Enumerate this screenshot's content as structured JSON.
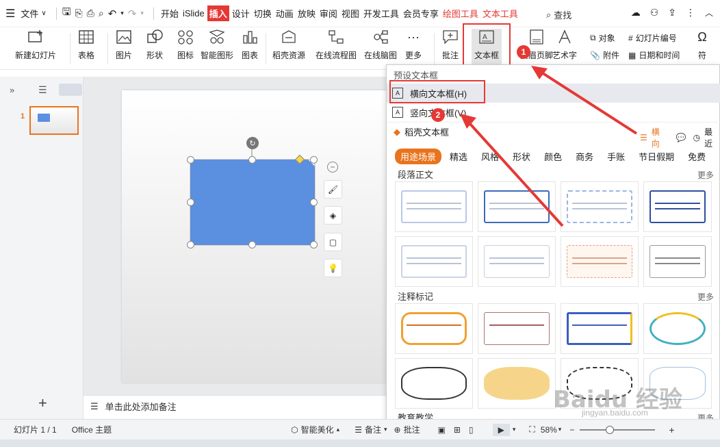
{
  "menubar": {
    "file_label": "文件",
    "tabs": [
      "开始",
      "iSlide",
      "插入",
      "设计",
      "切换",
      "动画",
      "放映",
      "审阅",
      "视图",
      "开发工具",
      "会员专享",
      "绘图工具",
      "文本工具"
    ],
    "search_label": "查找"
  },
  "ribbon": {
    "new_slide": "新建幻灯片",
    "table": "表格",
    "picture": "图片",
    "shape": "形状",
    "icon": "图标",
    "smart_graphic": "智能图形",
    "chart": "图表",
    "docer_resources": "稻壳资源",
    "online_flowchart": "在线流程图",
    "online_mindmap": "在线脑图",
    "more": "更多",
    "comment": "批注",
    "textbox": "文本框",
    "header_footer": "页眉页脚",
    "wordart": "艺术字",
    "object": "对象",
    "attachment": "附件",
    "slide_number": "幻灯片编号",
    "datetime": "日期和时间",
    "symbol": "符"
  },
  "leftpanel": {
    "slide_index": "1"
  },
  "notes": {
    "placeholder": "单击此处添加备注"
  },
  "dropdown": {
    "preset_title": "预设文本框",
    "horizontal": "横向文本框(H)",
    "vertical": "竖向文本框(V)",
    "docer_title": "稻壳文本框",
    "orientation": "横向",
    "recent": "最近",
    "categories": [
      "用途场景",
      "精选",
      "风格",
      "形状",
      "颜色",
      "商务",
      "手账",
      "节日假期",
      "免费"
    ],
    "section1": "段落正文",
    "section2": "注释标记",
    "section3": "教育教学",
    "more": "更多"
  },
  "status": {
    "slide_count": "幻灯片 1 / 1",
    "theme": "Office 主题",
    "smart_beautify": "智能美化",
    "notes": "备注",
    "comments": "批注",
    "zoom": "58%"
  },
  "annotations": {
    "badge1": "1",
    "badge2": "2"
  },
  "watermark": {
    "text": "Baidu 经验",
    "sub": "jingyan.baidu.com"
  },
  "colors": {
    "accent_red": "#e53935",
    "accent_orange": "#e8741d",
    "shape_blue": "#5b8fe0"
  }
}
